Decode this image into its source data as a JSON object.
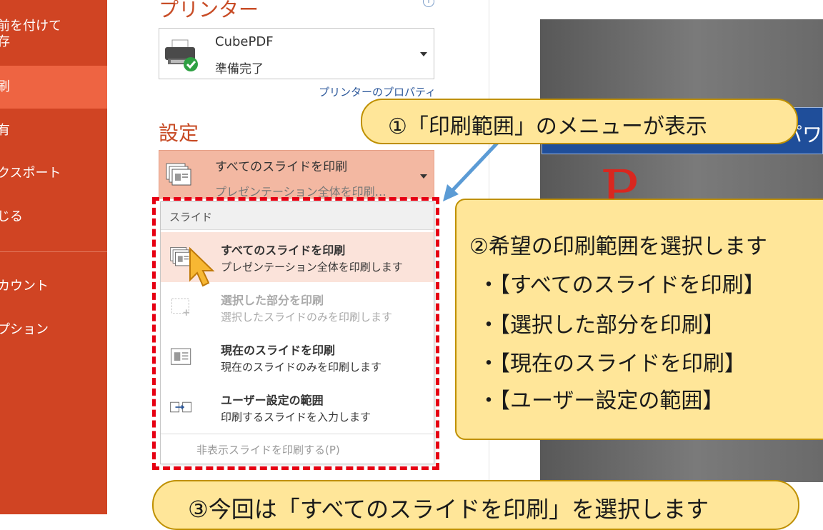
{
  "nav": {
    "items": [
      {
        "label": "前を付けて\n存"
      },
      {
        "label": "刷"
      },
      {
        "label": "有"
      },
      {
        "label": "クスポート"
      },
      {
        "label": "じる"
      },
      {
        "label": "カウント"
      },
      {
        "label": "プション"
      }
    ],
    "active_index": 1,
    "active_color": "#EE6442",
    "color": "#D04423"
  },
  "printer": {
    "section_title": "プリンター",
    "info_icon": "i",
    "name": "CubePDF",
    "status": "準備完了",
    "properties_link": "プリンターのプロパティ"
  },
  "settings": {
    "section_title": "設定",
    "selected_title": "すべてのスライドを印刷",
    "selected_subtitle": "プレゼンテーション全体を印刷…"
  },
  "dropdown": {
    "header": "スライド",
    "options": [
      {
        "title": "すべてのスライドを印刷",
        "subtitle": "プレゼンテーション全体を印刷します",
        "icon": "all-slides-icon",
        "highlighted": true,
        "enabled": true
      },
      {
        "title": "選択した部分を印刷",
        "subtitle": "選択したスライドのみを印刷します",
        "icon": "selection-icon",
        "highlighted": false,
        "enabled": false
      },
      {
        "title": "現在のスライドを印刷",
        "subtitle": "現在のスライドのみを印刷します",
        "icon": "current-slide-icon",
        "highlighted": false,
        "enabled": true
      },
      {
        "title": "ユーザー設定の範囲",
        "subtitle": "印刷するスライドを入力します",
        "icon": "custom-range-icon",
        "highlighted": false,
        "enabled": true
      }
    ],
    "hidden_slides_option": "非表示スライドを印刷する(P)"
  },
  "preview": {
    "band_text": "パワ",
    "big_letter": "P"
  },
  "annotations": {
    "callout1": "①「印刷範囲」のメニューが表示",
    "callout2_head": "②希望の印刷範囲を選択します",
    "callout2_items": [
      "・【すべてのスライドを印刷】",
      "・【選択した部分を印刷】",
      "・【現在のスライドを印刷】",
      "・【ユーザー設定の範囲】"
    ],
    "callout3": "③今回は「すべてのスライドを印刷」を選択します",
    "callout_fill": "#FFE699",
    "highlight_border": "#E60012"
  }
}
